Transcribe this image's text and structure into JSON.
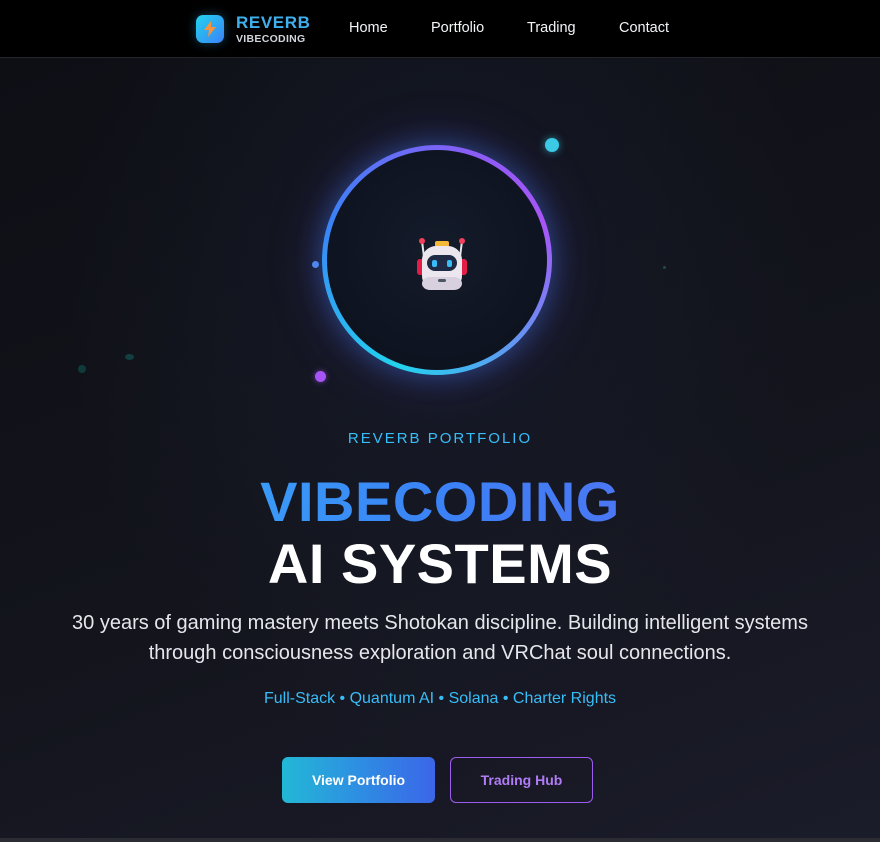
{
  "brand": {
    "name": "REVERB",
    "subtitle": "VIBECODING",
    "logo_icon": "lightning-bolt-icon"
  },
  "nav": {
    "links": [
      {
        "label": "Home"
      },
      {
        "label": "Portfolio"
      },
      {
        "label": "Trading"
      },
      {
        "label": "Contact"
      }
    ]
  },
  "hero": {
    "avatar_icon": "robot-icon",
    "eyebrow": "REVERB PORTFOLIO",
    "title_line1": "VIBECODING",
    "title_line2": "AI SYSTEMS",
    "description_line1": "30 years of gaming mastery meets Shotokan discipline. Building intelligent systems",
    "description_line2": "through consciousness exploration and VRChat soul connections.",
    "tags": "Full-Stack • Quantum AI • Solana • Charter Rights",
    "primary_button": "View Portfolio",
    "secondary_button": "Trading Hub"
  },
  "colors": {
    "accent_cyan": "#38bdf8",
    "accent_blue": "#3b82f6",
    "accent_purple": "#a855f7",
    "background": "#111218"
  }
}
